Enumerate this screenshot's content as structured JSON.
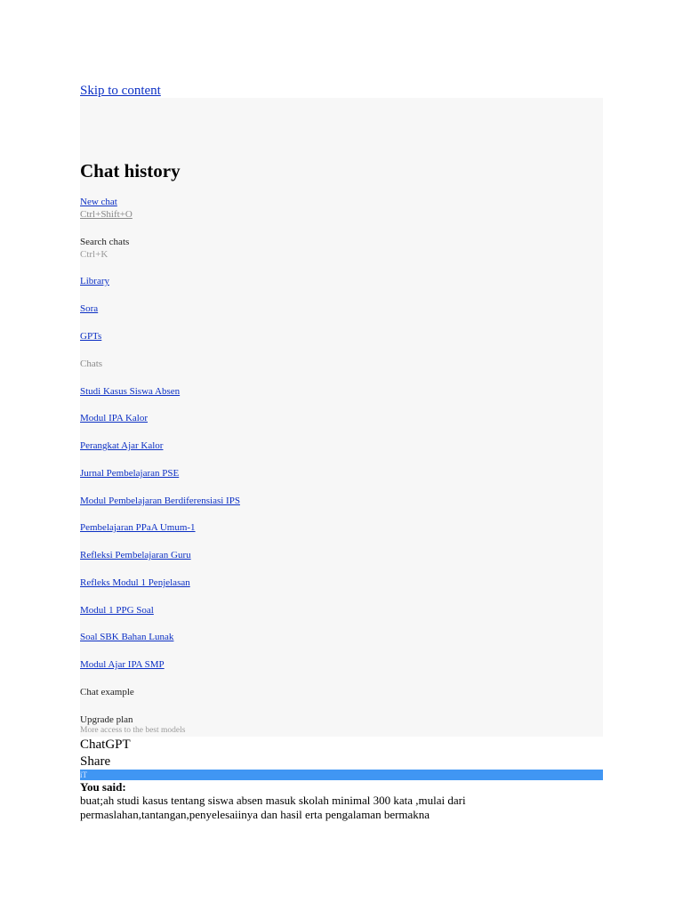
{
  "skip_link": "Skip to content",
  "sidebar": {
    "title": "Chat history",
    "new_chat": {
      "label": "New chat",
      "shortcut": "Ctrl+Shift+O"
    },
    "search": {
      "label": "Search chats",
      "shortcut": "Ctrl+K"
    },
    "nav": [
      {
        "label": "Library"
      },
      {
        "label": "Sora"
      },
      {
        "label": "GPTs"
      }
    ],
    "section_label": "Chats",
    "chats": [
      {
        "label": "Studi Kasus Siswa Absen"
      },
      {
        "label": "Modul IPA Kalor"
      },
      {
        "label": "Perangkat Ajar Kalor"
      },
      {
        "label": "Jurnal Pembelajaran PSE"
      },
      {
        "label": "Modul Pembelajaran Berdiferensiasi IPS"
      },
      {
        "label": "Pembelajaran PPaA Umum-1"
      },
      {
        "label": "Refleksi Pembelajaran Guru"
      },
      {
        "label": "Refleks Modul 1 Penjelasan"
      },
      {
        "label": "Modul 1 PPG Soal"
      },
      {
        "label": "Soal SBK Bahan Lunak"
      },
      {
        "label": "Modul Ajar IPA SMP"
      }
    ],
    "chat_example": "Chat example",
    "upgrade": {
      "label": "Upgrade plan",
      "subtitle": "More access to the best models"
    }
  },
  "main": {
    "title": "ChatGPT",
    "share_label": "Share",
    "bar_text": "iT",
    "bar_color": "#4096f3",
    "you_said_label": "You said:",
    "message": "buat;ah studi kasus tentang siswa absen masuk skolah minimal 300 kata ,mulai dari permaslahan,tantangan,penyelesaiinya dan hasil erta pengalaman bermakna"
  }
}
